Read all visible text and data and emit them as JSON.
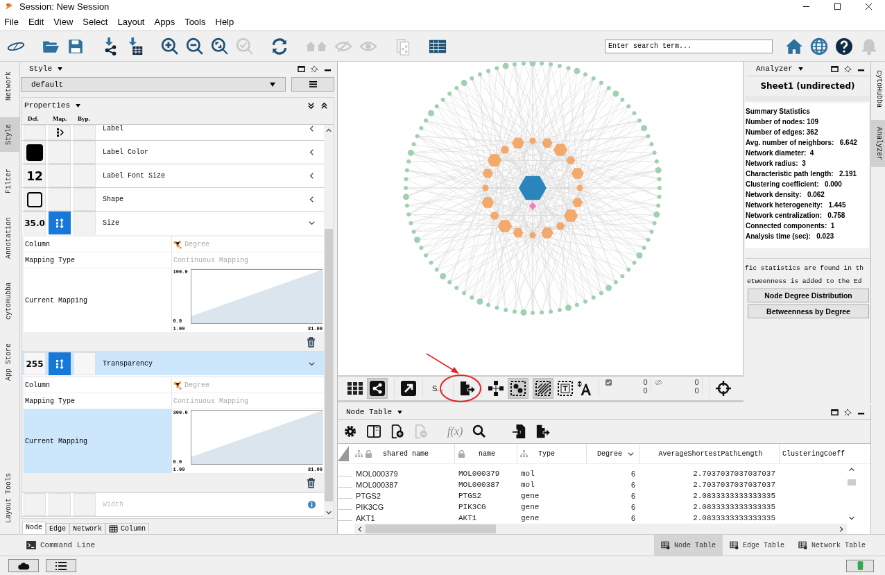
{
  "window": {
    "title": "Session: New Session"
  },
  "menu": [
    "File",
    "Edit",
    "View",
    "Select",
    "Layout",
    "Apps",
    "Tools",
    "Help"
  ],
  "search": {
    "placeholder": "Enter search term..."
  },
  "left_tabs": [
    {
      "label": "Network",
      "selected": false
    },
    {
      "label": "Style",
      "selected": true
    },
    {
      "label": "Filter",
      "selected": false
    },
    {
      "label": "Annotation",
      "selected": false
    },
    {
      "label": "cytoHubba",
      "selected": false
    },
    {
      "label": "App Store",
      "selected": false
    },
    {
      "label": "Layout Tools",
      "selected": false
    }
  ],
  "style_panel": {
    "title": "Style",
    "style_name": "default",
    "properties_title": "Properties",
    "column_headers": [
      "Def.",
      "Map.",
      "Byp."
    ],
    "properties": [
      {
        "name": "Label",
        "default": {
          "kind": "blank"
        },
        "mapping": {
          "kind": "passthrough"
        },
        "expanded": false,
        "selected": false,
        "disabled": false
      },
      {
        "name": "Label Color",
        "default": {
          "kind": "swatch"
        },
        "expanded": false,
        "selected": false,
        "disabled": false
      },
      {
        "name": "Label Font Size",
        "default": {
          "kind": "text",
          "text": "12"
        },
        "expanded": false,
        "selected": false,
        "disabled": false
      },
      {
        "name": "Shape",
        "default": {
          "kind": "shape"
        },
        "expanded": false,
        "selected": false,
        "disabled": false
      },
      {
        "name": "Size",
        "default": {
          "kind": "text",
          "text": "35.0"
        },
        "mapping": {
          "kind": "continuous"
        },
        "expanded": true,
        "selected": false,
        "disabled": false,
        "details": {
          "column_label": "Column",
          "column": "Degree",
          "type_label": "Mapping Type",
          "type": "Continuous Mapping",
          "current_label": "Current Mapping",
          "current_selected": false,
          "y_max": "100.0",
          "y_min": "0.0",
          "x_min": "1.00",
          "x_max": "81.00"
        }
      },
      {
        "name": "Transparency",
        "default": {
          "kind": "text",
          "text": "255"
        },
        "mapping": {
          "kind": "continuous"
        },
        "expanded": true,
        "selected": true,
        "disabled": false,
        "details": {
          "column_label": "Column",
          "column": "Degree",
          "type_label": "Mapping Type",
          "type": "Continuous Mapping",
          "current_label": "Current Mapping",
          "current_selected": true,
          "y_max": "300.0",
          "y_min": "0.0",
          "x_min": "1.00",
          "x_max": "81.00"
        }
      },
      {
        "name": "Width",
        "default": {
          "kind": "blank"
        },
        "expanded": false,
        "selected": false,
        "disabled": true
      }
    ],
    "bottom_tabs": [
      {
        "label": "Node",
        "selected": true
      },
      {
        "label": "Edge",
        "selected": false
      },
      {
        "label": "Network",
        "selected": false
      },
      {
        "label": "Column",
        "selected": false
      }
    ]
  },
  "network_toolbar": {
    "label": "S...",
    "selected_nodes": "0",
    "selected_edges": "0",
    "hidden_nodes": "0",
    "hidden_edges": "0"
  },
  "node_table": {
    "title": "Node Table",
    "formula": "f(x)",
    "columns": [
      "shared name",
      "name",
      "Type",
      "Degree",
      "AverageShortestPathLength",
      "ClusteringCoeff"
    ],
    "rows": [
      [
        "MOL000379",
        "MOL000379",
        "mol",
        "6",
        "2.7037037037037037"
      ],
      [
        "MOL000387",
        "MOL000387",
        "mol",
        "6",
        "2.7037037037037037"
      ],
      [
        "PTGS2",
        "PTGS2",
        "gene",
        "6",
        "2.0833333333333335"
      ],
      [
        "PIK3CG",
        "PIK3CG",
        "gene",
        "6",
        "2.0833333333333335"
      ],
      [
        "AKT1",
        "AKT1",
        "gene",
        "6",
        "2.0833333333333335"
      ]
    ]
  },
  "analyzer": {
    "title": "Analyzer",
    "sheet": "Sheet1 (undirected)",
    "heading": "Summary Statistics",
    "stats": [
      "Number of nodes: 109",
      "Number of edges: 362",
      "Avg. number of neighbors:   6.642",
      "Network diameter:  4",
      "Network radius:  3",
      "Characteristic path length:   2.191",
      "Clustering coefficient:   0.000",
      "Network density:   0.062",
      "Network heterogeneity:   1.445",
      "Network centralization:   0.758",
      "Connected components:  1",
      "Analysis time (sec):   0.023"
    ],
    "notes": [
      "fic statistics are found in th",
      "etweenness is added to the Ed"
    ],
    "buttons": [
      "Node Degree Distribution",
      "Betweenness by Degree"
    ]
  },
  "right_tabs": [
    {
      "label": "cytoHubba",
      "selected": false
    },
    {
      "label": "Analyzer",
      "selected": true
    }
  ],
  "command_line": "Command Line",
  "table_tabs": [
    {
      "label": "Node Table",
      "selected": true
    },
    {
      "label": "Edge Table",
      "selected": false
    },
    {
      "label": "Network Table",
      "selected": false
    }
  ]
}
